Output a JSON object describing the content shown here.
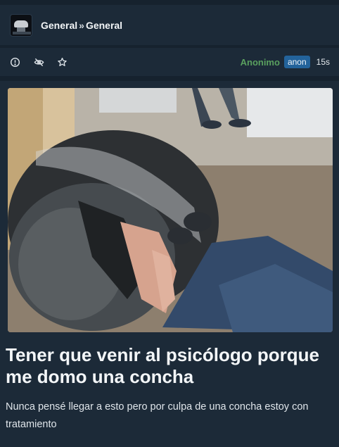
{
  "header": {
    "community": "General",
    "separator": "»",
    "channel": "General"
  },
  "post_meta": {
    "icons": [
      "alert-circle-icon",
      "eye-off-icon",
      "star-icon"
    ],
    "author": "Anonimo",
    "badge": "anon",
    "age": "15s"
  },
  "post": {
    "title": "Tener que venir al psicólogo porque me domo una concha",
    "body": "Nunca pensé llegar a esto pero por culpa de una concha estoy con tratamiento"
  },
  "colors": {
    "background": "#16222e",
    "panel": "#1c2a38",
    "author": "#5aa05f",
    "badge": "#23639b"
  }
}
